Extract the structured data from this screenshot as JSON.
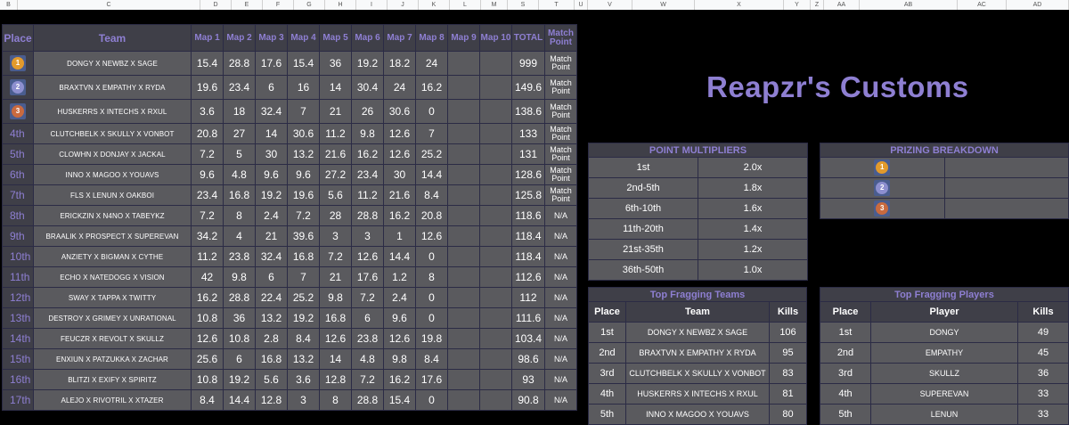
{
  "column_headers": [
    "B",
    "C",
    "D",
    "E",
    "F",
    "G",
    "H",
    "I",
    "J",
    "K",
    "L",
    "M",
    "S",
    "T",
    "U",
    "V",
    "W",
    "X",
    "Y",
    "Z",
    "AA",
    "AB",
    "AC",
    "AD"
  ],
  "title": "Reapzr's Customs",
  "standings": {
    "headers": [
      "Place",
      "Team",
      "Map 1",
      "Map 2",
      "Map 3",
      "Map 4",
      "Map 5",
      "Map 6",
      "Map 7",
      "Map 8",
      "Map 9",
      "Map 10",
      "TOTAL",
      "Match Point"
    ],
    "rows": [
      {
        "place": "1",
        "team": "DONGY X NEWBZ X SAGE",
        "maps": [
          "15.4",
          "28.8",
          "17.6",
          "15.4",
          "36",
          "19.2",
          "18.2",
          "24",
          "",
          ""
        ],
        "total": "999",
        "status": "Match Point"
      },
      {
        "place": "2",
        "team": "BRAXTVN X EMPATHY X RYDA",
        "maps": [
          "19.6",
          "23.4",
          "6",
          "16",
          "14",
          "30.4",
          "24",
          "16.2",
          "",
          ""
        ],
        "total": "149.6",
        "status": "Match Point"
      },
      {
        "place": "3",
        "team": "HUSKERRS X INTECHS X RXUL",
        "maps": [
          "3.6",
          "18",
          "32.4",
          "7",
          "21",
          "26",
          "30.6",
          "0",
          "",
          ""
        ],
        "total": "138.6",
        "status": "Match Point"
      },
      {
        "place": "4th",
        "team": "CLUTCHBELK X SKULLY X VONBOT",
        "maps": [
          "20.8",
          "27",
          "14",
          "30.6",
          "11.2",
          "9.8",
          "12.6",
          "7",
          "",
          ""
        ],
        "total": "133",
        "status": "Match Point"
      },
      {
        "place": "5th",
        "team": "CLOWHN X DONJAY X JACKAL",
        "maps": [
          "7.2",
          "5",
          "30",
          "13.2",
          "21.6",
          "16.2",
          "12.6",
          "25.2",
          "",
          ""
        ],
        "total": "131",
        "status": "Match Point"
      },
      {
        "place": "6th",
        "team": "INNO X MAGOO X YOUAVS",
        "maps": [
          "9.6",
          "4.8",
          "9.6",
          "9.6",
          "27.2",
          "23.4",
          "30",
          "14.4",
          "",
          ""
        ],
        "total": "128.6",
        "status": "Match Point"
      },
      {
        "place": "7th",
        "team": "FLS X LENUN X OAKBOI",
        "maps": [
          "23.4",
          "16.8",
          "19.2",
          "19.6",
          "5.6",
          "11.2",
          "21.6",
          "8.4",
          "",
          ""
        ],
        "total": "125.8",
        "status": "Match Point"
      },
      {
        "place": "8th",
        "team": "ERICKZIN X N4NO X TABEYKZ",
        "maps": [
          "7.2",
          "8",
          "2.4",
          "7.2",
          "28",
          "28.8",
          "16.2",
          "20.8",
          "",
          ""
        ],
        "total": "118.6",
        "status": "N/A"
      },
      {
        "place": "9th",
        "team": "BRAALIK X PROSPECT X SUPEREVAN",
        "maps": [
          "34.2",
          "4",
          "21",
          "39.6",
          "3",
          "3",
          "1",
          "12.6",
          "",
          ""
        ],
        "total": "118.4",
        "status": "N/A"
      },
      {
        "place": "10th",
        "team": "ANZIETY X BIGMAN X CYTHE",
        "maps": [
          "11.2",
          "23.8",
          "32.4",
          "16.8",
          "7.2",
          "12.6",
          "14.4",
          "0",
          "",
          ""
        ],
        "total": "118.4",
        "status": "N/A"
      },
      {
        "place": "11th",
        "team": "ECHO X NATEDOGG X VISION",
        "maps": [
          "42",
          "9.8",
          "6",
          "7",
          "21",
          "17.6",
          "1.2",
          "8",
          "",
          ""
        ],
        "total": "112.6",
        "status": "N/A"
      },
      {
        "place": "12th",
        "team": "SWAY X TAPPA X TWITTY",
        "maps": [
          "16.2",
          "28.8",
          "22.4",
          "25.2",
          "9.8",
          "7.2",
          "2.4",
          "0",
          "",
          ""
        ],
        "total": "112",
        "status": "N/A"
      },
      {
        "place": "13th",
        "team": "DESTROY X GRIMEY X UNRATIONAL",
        "maps": [
          "10.8",
          "36",
          "13.2",
          "19.2",
          "16.8",
          "6",
          "9.6",
          "0",
          "",
          ""
        ],
        "total": "111.6",
        "status": "N/A"
      },
      {
        "place": "14th",
        "team": "FEUCZR X REVOLT X SKULLZ",
        "maps": [
          "12.6",
          "10.8",
          "2.8",
          "8.4",
          "12.6",
          "23.8",
          "12.6",
          "19.8",
          "",
          ""
        ],
        "total": "103.4",
        "status": "N/A"
      },
      {
        "place": "15th",
        "team": "ENXIUN X PATZUKKA X ZACHAR",
        "maps": [
          "25.6",
          "6",
          "16.8",
          "13.2",
          "14",
          "4.8",
          "9.8",
          "8.4",
          "",
          ""
        ],
        "total": "98.6",
        "status": "N/A"
      },
      {
        "place": "16th",
        "team": "BLITZI X EXIFY X SPIRITZ",
        "maps": [
          "10.8",
          "19.2",
          "5.6",
          "3.6",
          "12.8",
          "7.2",
          "16.2",
          "17.6",
          "",
          ""
        ],
        "total": "93",
        "status": "N/A"
      },
      {
        "place": "17th",
        "team": "ALEJO X RIVOTRIL X XTAZER",
        "maps": [
          "8.4",
          "14.4",
          "12.8",
          "3",
          "8",
          "28.8",
          "15.4",
          "0",
          "",
          ""
        ],
        "total": "90.8",
        "status": "N/A"
      }
    ]
  },
  "point_multipliers": {
    "title": "POINT MULTIPLIERS",
    "rows": [
      {
        "range": "1st",
        "mult": "2.0x"
      },
      {
        "range": "2nd-5th",
        "mult": "1.8x"
      },
      {
        "range": "6th-10th",
        "mult": "1.6x"
      },
      {
        "range": "11th-20th",
        "mult": "1.4x"
      },
      {
        "range": "21st-35th",
        "mult": "1.2x"
      },
      {
        "range": "36th-50th",
        "mult": "1.0x"
      }
    ]
  },
  "prizing": {
    "title": "PRIZING BREAKDOWN",
    "medals": [
      "1",
      "2",
      "3"
    ]
  },
  "top_teams": {
    "title": "Top Fragging Teams",
    "headers": [
      "Place",
      "Team",
      "Kills"
    ],
    "rows": [
      {
        "place": "1st",
        "team": "DONGY X NEWBZ X SAGE",
        "kills": "106"
      },
      {
        "place": "2nd",
        "team": "BRAXTVN X EMPATHY X RYDA",
        "kills": "95"
      },
      {
        "place": "3rd",
        "team": "CLUTCHBELK X SKULLY X VONBOT",
        "kills": "83"
      },
      {
        "place": "4th",
        "team": "HUSKERRS X INTECHS X RXUL",
        "kills": "81"
      },
      {
        "place": "5th",
        "team": "INNO X MAGOO X YOUAVS",
        "kills": "80"
      }
    ]
  },
  "top_players": {
    "title": "Top Fragging Players",
    "headers": [
      "Place",
      "Player",
      "Kills"
    ],
    "rows": [
      {
        "place": "1st",
        "player": "DONGY",
        "kills": "49"
      },
      {
        "place": "2nd",
        "player": "EMPATHY",
        "kills": "45"
      },
      {
        "place": "3rd",
        "player": "SKULLZ",
        "kills": "36"
      },
      {
        "place": "4th",
        "player": "SUPEREVAN",
        "kills": "33"
      },
      {
        "place": "5th",
        "player": "LENUN",
        "kills": "33"
      }
    ]
  }
}
